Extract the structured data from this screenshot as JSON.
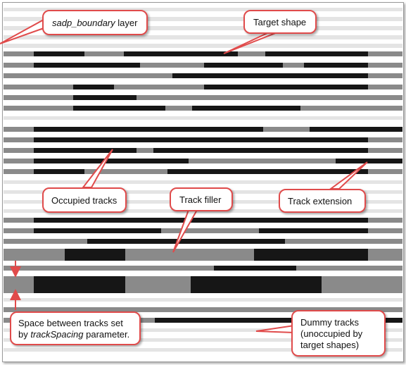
{
  "colors": {
    "dummy_track": "#e4e4e4",
    "filler": "#8a8a8a",
    "target": "#161616",
    "callout_border": "#e04b4b",
    "arrow": "#e04b4b"
  },
  "callouts": {
    "boundary": {
      "prefix": "",
      "italic": "sadp_boundary",
      "suffix": " layer"
    },
    "target": {
      "text": "Target shape"
    },
    "occupied": {
      "text": "Occupied tracks"
    },
    "filler": {
      "text": "Track filler"
    },
    "extension": {
      "text": "Track extension"
    },
    "spacing": {
      "line1": "Space between tracks set",
      "line2_prefix": "by ",
      "line2_italic": "trackSpacing",
      "line2_suffix": " parameter."
    },
    "dummy": {
      "line1": "Dummy tracks",
      "line2": "(unoccupied by",
      "line3": "target shapes)"
    }
  }
}
